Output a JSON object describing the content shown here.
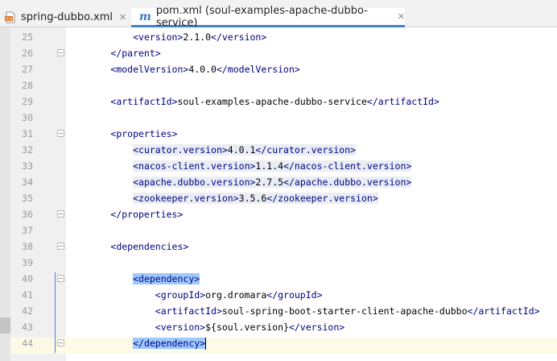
{
  "tabs": [
    {
      "label": "spring-dubbo.xml",
      "icon": "xml-file-icon",
      "active": false
    },
    {
      "label": "pom.xml (soul-examples-apache-dubbo-service)",
      "icon": "maven-m-icon",
      "active": true
    }
  ],
  "close_glyph": "✕",
  "lines": [
    {
      "num": "25",
      "indent": "        ",
      "open": "<version>",
      "text": "2.1.0",
      "close": "</version>"
    },
    {
      "num": "26",
      "indent": "    ",
      "open": "",
      "text": "",
      "close": "</parent>"
    },
    {
      "num": "27",
      "indent": "    ",
      "open": "<modelVersion>",
      "text": "4.0.0",
      "close": "</modelVersion>"
    },
    {
      "num": "28",
      "indent": "",
      "open": "",
      "text": "",
      "close": ""
    },
    {
      "num": "29",
      "indent": "    ",
      "open": "<artifactId>",
      "text": "soul-examples-apache-dubbo-service",
      "close": "</artifactId>"
    },
    {
      "num": "30",
      "indent": "",
      "open": "",
      "text": "",
      "close": ""
    },
    {
      "num": "31",
      "indent": "    ",
      "open": "<properties>",
      "text": "",
      "close": ""
    },
    {
      "num": "32",
      "indent": "        ",
      "open": "<curator.version>",
      "text": "4.0.1",
      "close": "</curator.version>"
    },
    {
      "num": "33",
      "indent": "        ",
      "open": "<nacos-client.version>",
      "text": "1.1.4",
      "close": "</nacos-client.version>"
    },
    {
      "num": "34",
      "indent": "        ",
      "open": "<apache.dubbo.version>",
      "text": "2.7.5",
      "close": "</apache.dubbo.version>"
    },
    {
      "num": "35",
      "indent": "        ",
      "open": "<zookeeper.version>",
      "text": "3.5.6",
      "close": "</zookeeper.version>"
    },
    {
      "num": "36",
      "indent": "    ",
      "open": "",
      "text": "",
      "close": "</properties>"
    },
    {
      "num": "37",
      "indent": "",
      "open": "",
      "text": "",
      "close": ""
    },
    {
      "num": "38",
      "indent": "    ",
      "open": "<dependencies>",
      "text": "",
      "close": ""
    },
    {
      "num": "39",
      "indent": "",
      "open": "",
      "text": "",
      "close": ""
    },
    {
      "num": "40",
      "indent": "        ",
      "open": "<dependency>",
      "text": "",
      "close": ""
    },
    {
      "num": "41",
      "indent": "            ",
      "open": "<groupId>",
      "text": "org.dromara",
      "close": "</groupId>"
    },
    {
      "num": "42",
      "indent": "            ",
      "open": "<artifactId>",
      "text": "soul-spring-boot-starter-client-apache-dubbo",
      "close": "</artifactId>"
    },
    {
      "num": "43",
      "indent": "            ",
      "open": "<version>",
      "text": "${soul.version}",
      "close": "</version>"
    },
    {
      "num": "44",
      "indent": "        ",
      "open": "",
      "text": "",
      "close": "</dependency>"
    }
  ]
}
